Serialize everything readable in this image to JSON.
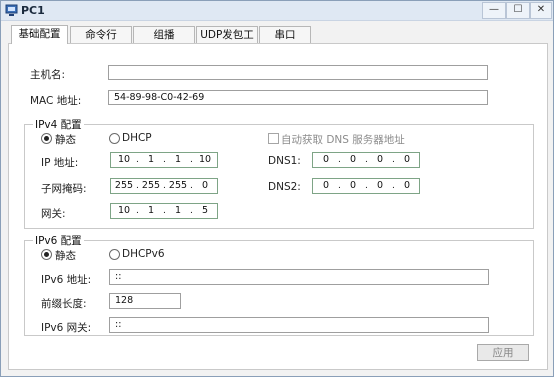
{
  "window": {
    "title": "PC1",
    "buttons": {
      "minimize": "—",
      "maximize": "☐",
      "close": "✕"
    }
  },
  "tabs": [
    "基础配置",
    "命令行",
    "组播",
    "UDP发包工具",
    "串口"
  ],
  "basic": {
    "hostname_label": "主机名:",
    "hostname_value": "",
    "mac_label": "MAC 地址:",
    "mac_value": "54-89-98-C0-42-69"
  },
  "ipv4": {
    "title": "IPv4 配置",
    "static_label": "静态",
    "dhcp_label": "DHCP",
    "auto_dns_label": "自动获取 DNS 服务器地址",
    "ip_label": "IP 地址:",
    "ip": [
      "10",
      "1",
      "1",
      "10"
    ],
    "mask_label": "子网掩码:",
    "mask": [
      "255",
      "255",
      "255",
      "0"
    ],
    "gateway_label": "网关:",
    "gateway": [
      "10",
      "1",
      "1",
      "5"
    ],
    "dns1_label": "DNS1:",
    "dns1": [
      "0",
      "0",
      "0",
      "0"
    ],
    "dns2_label": "DNS2:",
    "dns2": [
      "0",
      "0",
      "0",
      "0"
    ],
    "mode": "static"
  },
  "ipv6": {
    "title": "IPv6 配置",
    "static_label": "静态",
    "dhcp_label": "DHCPv6",
    "address_label": "IPv6 地址:",
    "address_value": "::",
    "prefix_label": "前缀长度:",
    "prefix_value": "128",
    "gateway_label": "IPv6 网关:",
    "gateway_value": "::",
    "mode": "static"
  },
  "apply_label": "应用"
}
